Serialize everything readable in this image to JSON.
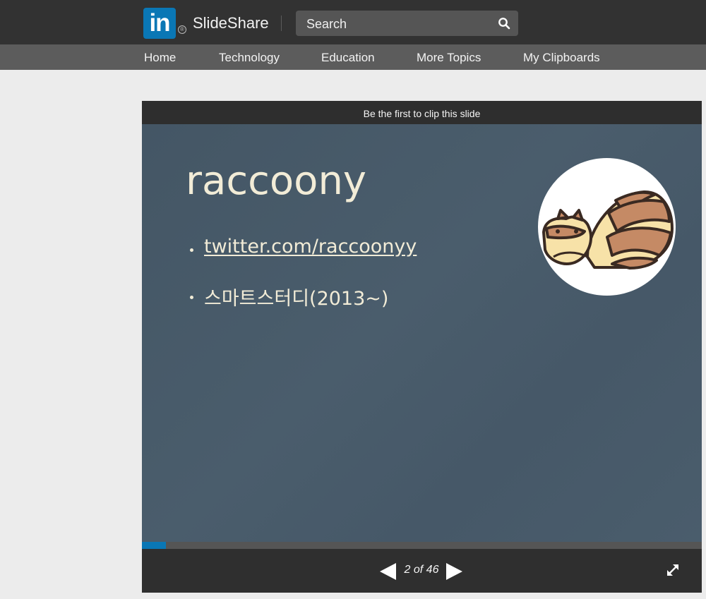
{
  "header": {
    "logo_text": "in",
    "registered_mark": "®",
    "brand": "SlideShare",
    "search": {
      "placeholder": "Search"
    }
  },
  "nav": {
    "items": [
      {
        "label": "Home"
      },
      {
        "label": "Technology"
      },
      {
        "label": "Education"
      },
      {
        "label": "More Topics"
      },
      {
        "label": "My Clipboards"
      }
    ]
  },
  "player": {
    "clip_prompt": "Be the first to clip this slide",
    "slide": {
      "title": "raccoony",
      "bullets": [
        {
          "text": "twitter.com/raccoonyy",
          "is_link": true
        },
        {
          "text": "스마트스터디(2013~)",
          "is_link": false
        }
      ]
    },
    "progress_fraction": 0.0435,
    "page_indicator": "2 of 46",
    "current_page": 2,
    "total_pages": 46
  },
  "colors": {
    "topbar": "#323232",
    "navbar": "#5c5c5c",
    "linkedin_blue": "#0a77b5",
    "slide_bg": "#4a5d6c",
    "slide_text": "#f2ecd7"
  },
  "icons": {
    "search": "search-icon",
    "prev": "triangle-left-icon",
    "next": "triangle-right-icon",
    "fullscreen": "expand-arrows-icon"
  }
}
